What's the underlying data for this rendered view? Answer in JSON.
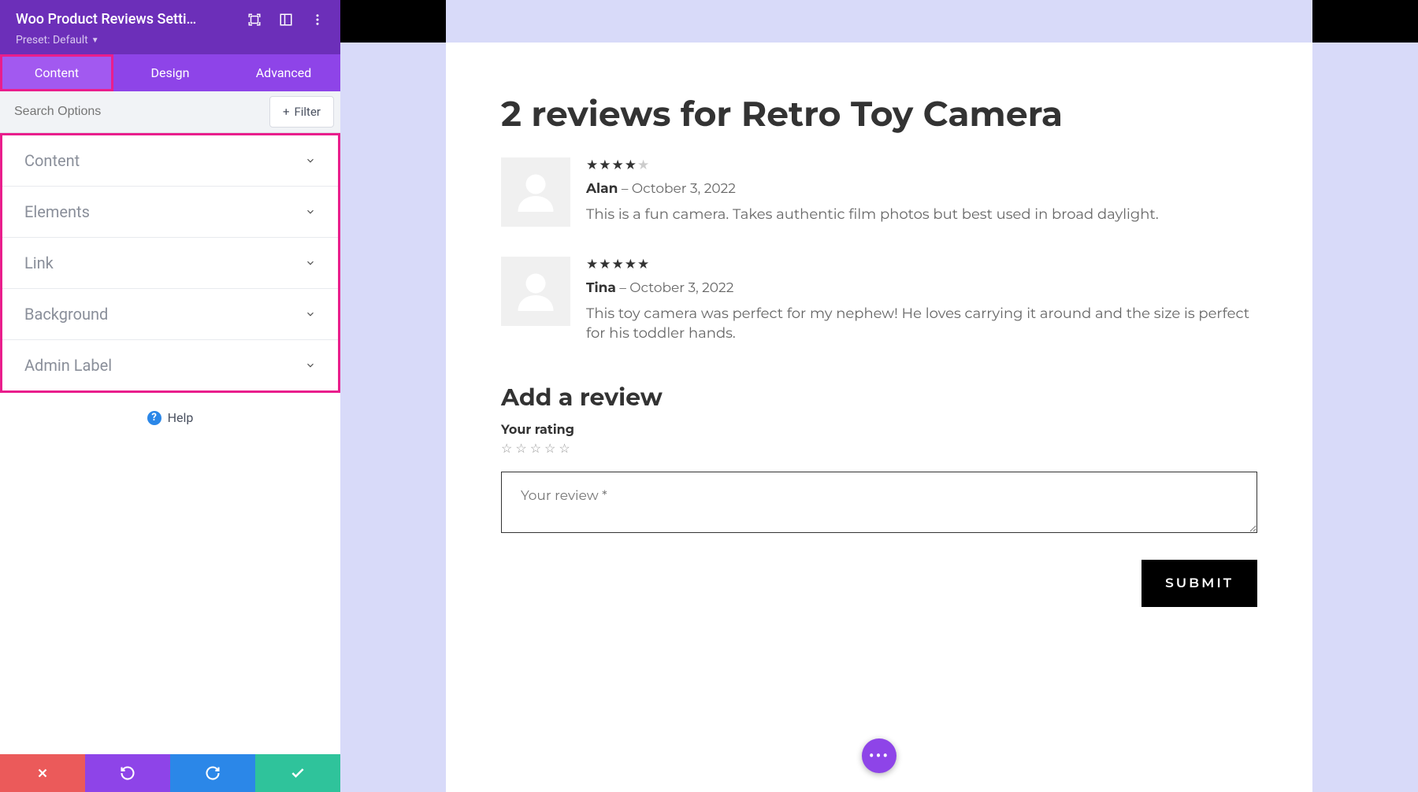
{
  "sidebar": {
    "title": "Woo Product Reviews Setti…",
    "preset_label": "Preset: Default",
    "tabs": [
      {
        "label": "Content",
        "active": true
      },
      {
        "label": "Design",
        "active": false
      },
      {
        "label": "Advanced",
        "active": false
      }
    ],
    "search_placeholder": "Search Options",
    "filter_label": "Filter",
    "options": [
      {
        "label": "Content"
      },
      {
        "label": "Elements"
      },
      {
        "label": "Link"
      },
      {
        "label": "Background"
      },
      {
        "label": "Admin Label"
      }
    ],
    "help_label": "Help"
  },
  "reviews": {
    "heading": "2 reviews for Retro Toy Camera",
    "items": [
      {
        "author": "Alan",
        "date": "October 3, 2022",
        "rating": 4,
        "text": "This is a fun camera. Takes authentic film photos but best used in broad daylight."
      },
      {
        "author": "Tina",
        "date": "October 3, 2022",
        "rating": 5,
        "text": "This toy camera was perfect for my nephew! He loves carrying it around and the size is perfect for his toddler hands."
      }
    ]
  },
  "form": {
    "heading": "Add a review",
    "rating_label": "Your rating",
    "textarea_placeholder": "Your review *",
    "submit_label": "SUBMIT"
  }
}
